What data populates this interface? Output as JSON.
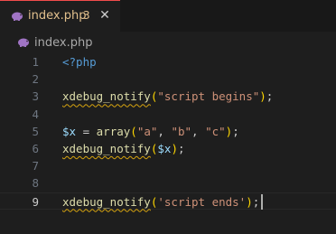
{
  "tab": {
    "filename": "index.php",
    "problem_count": "3",
    "close_glyph": "✕",
    "icon": "php-elephant-icon",
    "accent_color": "#e2c08d"
  },
  "breadcrumb": {
    "filename": "index.php",
    "icon": "php-elephant-icon"
  },
  "editor": {
    "current_line": 9,
    "lines": [
      {
        "num": "1",
        "parts": [
          {
            "t": "<?php",
            "c": "kw"
          }
        ]
      },
      {
        "num": "2",
        "parts": []
      },
      {
        "num": "3",
        "parts": [
          {
            "t": "xdebug_notify",
            "c": "fn"
          },
          {
            "t": "(",
            "c": "br1"
          },
          {
            "t": "\"script begins\"",
            "c": "str"
          },
          {
            "t": ")",
            "c": "br1"
          },
          {
            "t": ";",
            "c": "punc"
          }
        ]
      },
      {
        "num": "4",
        "parts": []
      },
      {
        "num": "5",
        "parts": [
          {
            "t": "$x",
            "c": "var"
          },
          {
            "t": " = ",
            "c": "punc"
          },
          {
            "t": "array",
            "c": "fn-plain"
          },
          {
            "t": "(",
            "c": "br1"
          },
          {
            "t": "\"a\"",
            "c": "str"
          },
          {
            "t": ", ",
            "c": "punc"
          },
          {
            "t": "\"b\"",
            "c": "str"
          },
          {
            "t": ", ",
            "c": "punc"
          },
          {
            "t": "\"c\"",
            "c": "str"
          },
          {
            "t": ")",
            "c": "br1"
          },
          {
            "t": ";",
            "c": "punc"
          }
        ]
      },
      {
        "num": "6",
        "parts": [
          {
            "t": "xdebug_notify",
            "c": "fn"
          },
          {
            "t": "(",
            "c": "br1"
          },
          {
            "t": "$x",
            "c": "var"
          },
          {
            "t": ")",
            "c": "br1"
          },
          {
            "t": ";",
            "c": "punc"
          }
        ]
      },
      {
        "num": "7",
        "parts": []
      },
      {
        "num": "8",
        "parts": []
      },
      {
        "num": "9",
        "parts": [
          {
            "t": "xdebug_notify",
            "c": "fn"
          },
          {
            "t": "(",
            "c": "br1"
          },
          {
            "t": "'script ends'",
            "c": "str"
          },
          {
            "t": ")",
            "c": "br1"
          },
          {
            "t": ";",
            "c": "punc"
          }
        ]
      }
    ]
  }
}
